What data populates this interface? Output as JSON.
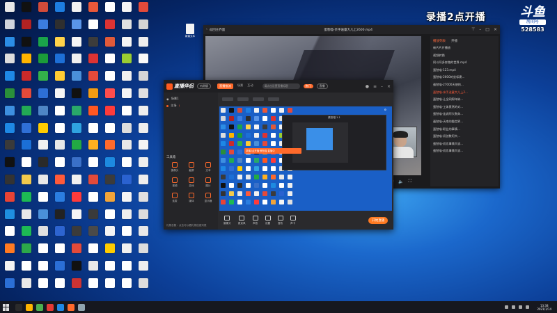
{
  "overlay": {
    "broadcast_notice": "录播2点开播"
  },
  "logo": {
    "mark": "斗鱼",
    "sub": "房间号",
    "room_number": "528583"
  },
  "desktop": {
    "icon_colors": [
      "#e8e8e8",
      "#111111",
      "#d24b3a",
      "#1d7de0",
      "#f2f2f2",
      "#e8583a",
      "#ffffff",
      "#f4f4f4",
      "#e34a3a",
      "#d0d4dc",
      "#b22222",
      "#3b7de0",
      "#2f2f2f",
      "#5a95e8",
      "#ffffff",
      "#d33",
      "#e0e0e0",
      "#d4d4d4",
      "#2b8de5",
      "#111",
      "#1aa34a",
      "#ffd24a",
      "#f5f5f5",
      "#3c3c3c",
      "#e05a3a",
      "#f4f4f4",
      "#eeeeee",
      "#ddd",
      "#ffb400",
      "#1b9b3a",
      "#1d6fd6",
      "#f0f0f0",
      "#d33",
      "#ffffff",
      "#9acd32",
      "#fafafa",
      "#1e88e5",
      "#cc2a2a",
      "#33b14a",
      "#ffcc33",
      "#4a90d9",
      "#e34a3a",
      "#ffffff",
      "#f0f0f0",
      "#d6d6d6",
      "#2a8f3a",
      "#e34a3a",
      "#2d6fd6",
      "#f5f5f5",
      "#111",
      "#f39c12",
      "#ff4d4d",
      "#f5f5f5",
      "#e0e0e0",
      "#3d8fe0",
      "#22aa55",
      "#4f86c6",
      "#ffffff",
      "#29a86a",
      "#ff5722",
      "#ff3b3b",
      "#ffffff",
      "#eeeeee",
      "#1e88e5",
      "#2f6fd6",
      "#ffcc00",
      "#ffffff",
      "#2fa3e0",
      "#ffffff",
      "#ffffff",
      "#dddddd",
      "#eeeeee",
      "#3a3a3a",
      "#1b6fd6",
      "#f0f0f0",
      "#e8e8e8",
      "#22aa44",
      "#ffb020",
      "#ff6a2b",
      "#e8e8e8",
      "#f4f4f4",
      "#111",
      "#ffffff",
      "#2a2a2a",
      "#ffffff",
      "#3a70c8",
      "#ffffff",
      "#1d8ae0",
      "#fefefe",
      "#eeeeee",
      "#333",
      "#f2c94c",
      "#e8e8e8",
      "#ff5a3a",
      "#f0f0f0",
      "#e34a3a",
      "#3b3b3b",
      "#2a62d0",
      "#eeeeee",
      "#ea4335",
      "#1db954",
      "#ffffff",
      "#2b7de0",
      "#ff3b3b",
      "#ffffff",
      "#f2a43a",
      "#f5f5f5",
      "#e0e0e0",
      "#1f8fe0",
      "#e8e8e8",
      "#4a90d9",
      "#222",
      "#f5f5f5",
      "#3a3a3a",
      "#ffffff",
      "#eeeeee",
      "#dddddd",
      "#ffffff",
      "#1db954",
      "#e0e0e0",
      "#2d64d0",
      "#3b3b3b",
      "#4a4a4a",
      "#f4f4f4",
      "#ffffff",
      "#e8e8e8",
      "#ff7a22",
      "#2ca84a",
      "#ffffff",
      "#ffffff",
      "#e34a3a",
      "#ffffff",
      "#ffcc00",
      "#f0f0f0",
      "#dddddd",
      "#f4f4f4",
      "#ffffff",
      "#ffffff",
      "#2b6fd6",
      "#111",
      "#e8e8e8",
      "#ffffff",
      "#ffffff",
      "#eeeeee",
      "#2b6fd6",
      "#e8e8e8",
      "#ffffff",
      "#ffffff",
      "#cc3333",
      "#ffffff",
      "#ffffff",
      "#ffffff",
      "#dddddd"
    ]
  },
  "extra_file": {
    "label": "新建文本"
  },
  "player": {
    "back_label": "返回主界面",
    "title": "蛋愁喵-亲手送童大儿上2600.mp4",
    "playlist_tabs": [
      "播放列表",
      "开播"
    ],
    "playlist": [
      "新片片片播放",
      "视频转换",
      "阿斗阿多奔跑的世界.mp4",
      "蛋愁喵-123.mp4",
      "蛋愁喵-2600的坐标建...",
      "蛋愁喵-27000天使的...",
      "蛋愁喵-亲手送童大儿上2...",
      "蛋愁喵-让全网周年纳...",
      "蛋愁喵-工体竟然的对...",
      "蛋愁喵-连说阿大数奔...",
      "蛋愁喵-天南的猫世界...",
      "蛋愁喵-职业的事情...",
      "蛋愁喵-初创数阿大...",
      "蛋愁喵-初恋事情大说...",
      "蛋愁喵-初恋事情大说..."
    ]
  },
  "recorder": {
    "brand": "直播伴侣",
    "beta": "内测版",
    "tabs": [
      "直播推流",
      "场景",
      "互动"
    ],
    "search_placeholder": "请点击设置直播标题",
    "hot_button": "热门",
    "hot_label": "直播",
    "scenes": [
      "场景1",
      "主场"
    ],
    "scene_alert": "!",
    "tools_title": "工具箱",
    "tools": [
      "摄像头",
      "截屏",
      "文本",
      "视频",
      "游戏",
      "图片",
      "连麦",
      "媒体",
      "显示器"
    ],
    "bottom_note": "礼物总数：点击可以看礼物信息列表",
    "preview_header": "蛋愁喵·1.1",
    "toast": "录播2点开播·蛋愁喵·直播中",
    "actions": [
      "摄像头",
      "麦克风",
      "声音",
      "设置",
      "音效",
      "声卡"
    ],
    "start_button": "开始直播"
  },
  "taskbar": {
    "icon_colors": [
      "#2b2b2b",
      "#ffb400",
      "#4caf50",
      "#e53935",
      "#1e88e5",
      "#ff6a2b",
      "#90a4ae"
    ],
    "time": "13:38",
    "date": "2021/1/14"
  }
}
